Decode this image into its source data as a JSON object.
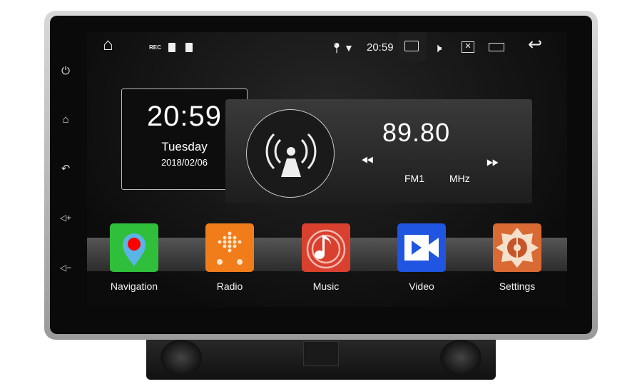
{
  "status_bar": {
    "time": "20:59",
    "rec_label": "REC",
    "icons": [
      "home-icon",
      "rec-icon",
      "sd-card-icon",
      "sd-card-icon",
      "location-icon",
      "wifi-icon",
      "camera-icon",
      "volume-icon",
      "close-window-icon",
      "recent-apps-icon",
      "back-icon"
    ]
  },
  "side_buttons": [
    "power-icon",
    "home-icon",
    "back-icon",
    "volume-up-icon",
    "volume-down-icon"
  ],
  "clock_widget": {
    "time": "20:59",
    "day": "Tuesday",
    "date": "2018/02/06"
  },
  "radio_widget": {
    "frequency": "89.80",
    "band": "FM1",
    "unit": "MHz"
  },
  "apps": [
    {
      "label": "Navigation",
      "color": "#2fbf3a"
    },
    {
      "label": "Radio",
      "color": "#f07d1a"
    },
    {
      "label": "Music",
      "color": "#d9402e"
    },
    {
      "label": "Video",
      "color": "#1f55e0"
    },
    {
      "label": "Settings",
      "color": "#d96a33"
    }
  ]
}
